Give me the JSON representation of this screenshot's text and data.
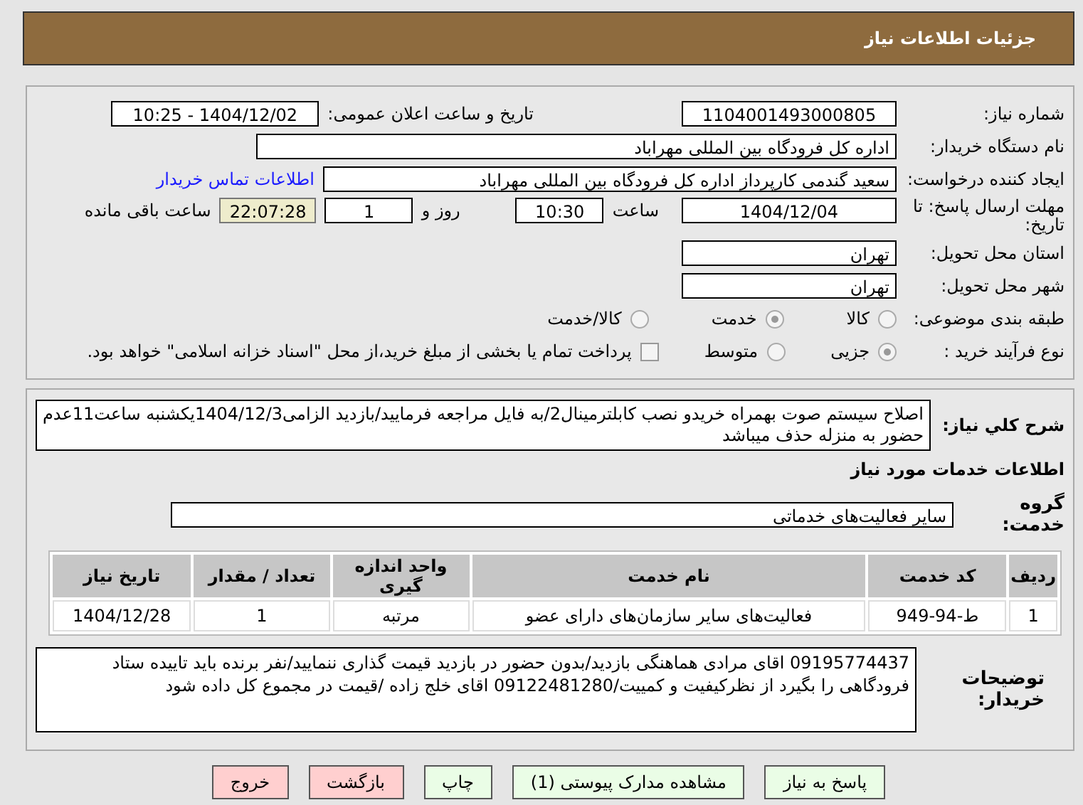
{
  "title": "جزئیات اطلاعات نیاز",
  "need_number": {
    "label": "شماره نیاز:",
    "value": "1104001493000805"
  },
  "announce": {
    "label": "تاریخ و ساعت اعلان عمومی:",
    "value": "1404/12/02 - 10:25"
  },
  "buyer_org": {
    "label": "نام دستگاه خریدار:",
    "value": "اداره کل فرودگاه بین المللی مهراباد"
  },
  "creator": {
    "label": "ایجاد کننده درخواست:",
    "value": "سعید گندمی کارپرداز اداره کل فرودگاه بین المللی مهراباد",
    "link": "اطلاعات تماس خریدار"
  },
  "deadline": {
    "label": "مهلت ارسال پاسخ: تا تاریخ:",
    "date": "1404/12/04",
    "time_label": "ساعت",
    "time": "10:30",
    "days_label": "روز و",
    "days": "1",
    "remaining": "22:07:28",
    "remaining_label": "ساعت باقی مانده"
  },
  "province": {
    "label": "استان محل تحویل:",
    "value": "تهران"
  },
  "city": {
    "label": "شهر محل تحویل:",
    "value": "تهران"
  },
  "category": {
    "label": "طبقه بندی موضوعی:",
    "options": [
      {
        "label": "کالا",
        "selected": false
      },
      {
        "label": "خدمت",
        "selected": true
      },
      {
        "label": "کالا/خدمت",
        "selected": false
      }
    ]
  },
  "process": {
    "label": "نوع فرآیند خرید :",
    "options": [
      {
        "kind": "radio",
        "label": "جزیی",
        "selected": true
      },
      {
        "kind": "radio",
        "label": "متوسط",
        "selected": false
      },
      {
        "kind": "checkbox",
        "label": "پرداخت تمام یا بخشی از مبلغ خرید،از محل \"اسناد خزانه اسلامی\" خواهد بود.",
        "checked": false
      }
    ]
  },
  "description": {
    "label": "شرح کلي نياز:",
    "value": "اصلاح سیستم صوت بهمراه خریدو نصب کابلترمینال2/به فایل مراجعه فرمایید/بازدید الزامی1404/12/3یکشنبه ساعت11عدم حضور به منزله حذف میباشد"
  },
  "services_title": "اطلاعات خدمات مورد نیاز",
  "service_group": {
    "label": "گروه خدمت:",
    "value": "سایر فعالیت‌های خدماتی"
  },
  "table": {
    "columns": [
      "ردیف",
      "کد خدمت",
      "نام خدمت",
      "واحد اندازه گیری",
      "تعداد / مقدار",
      "تاریخ نیاز"
    ],
    "rows": [
      [
        "1",
        "ط-94-949",
        "فعالیت‌های سایر سازمان‌های دارای عضو",
        "مرتبه",
        "1",
        "1404/12/28"
      ]
    ]
  },
  "notes": {
    "label": "توضیحات خریدار:",
    "value": "09195774437 اقای مرادی هماهنگی بازدید/بدون حضور در بازدید قیمت گذاری ننمایید/نفر برنده باید تاییده ستاد فرودگاهی را بگیرد از نظرکیفیت و کمییت/09122481280 اقای خلج زاده /قیمت در مجموع کل داده شود"
  },
  "buttons": [
    {
      "kind": "primary",
      "label": "پاسخ به نیاز"
    },
    {
      "kind": "primary",
      "label": "مشاهده مدارک پیوستی (1)"
    },
    {
      "kind": "primary",
      "label": "چاپ"
    },
    {
      "kind": "danger",
      "label": "بازگشت"
    },
    {
      "kind": "danger",
      "label": "خروج"
    }
  ]
}
